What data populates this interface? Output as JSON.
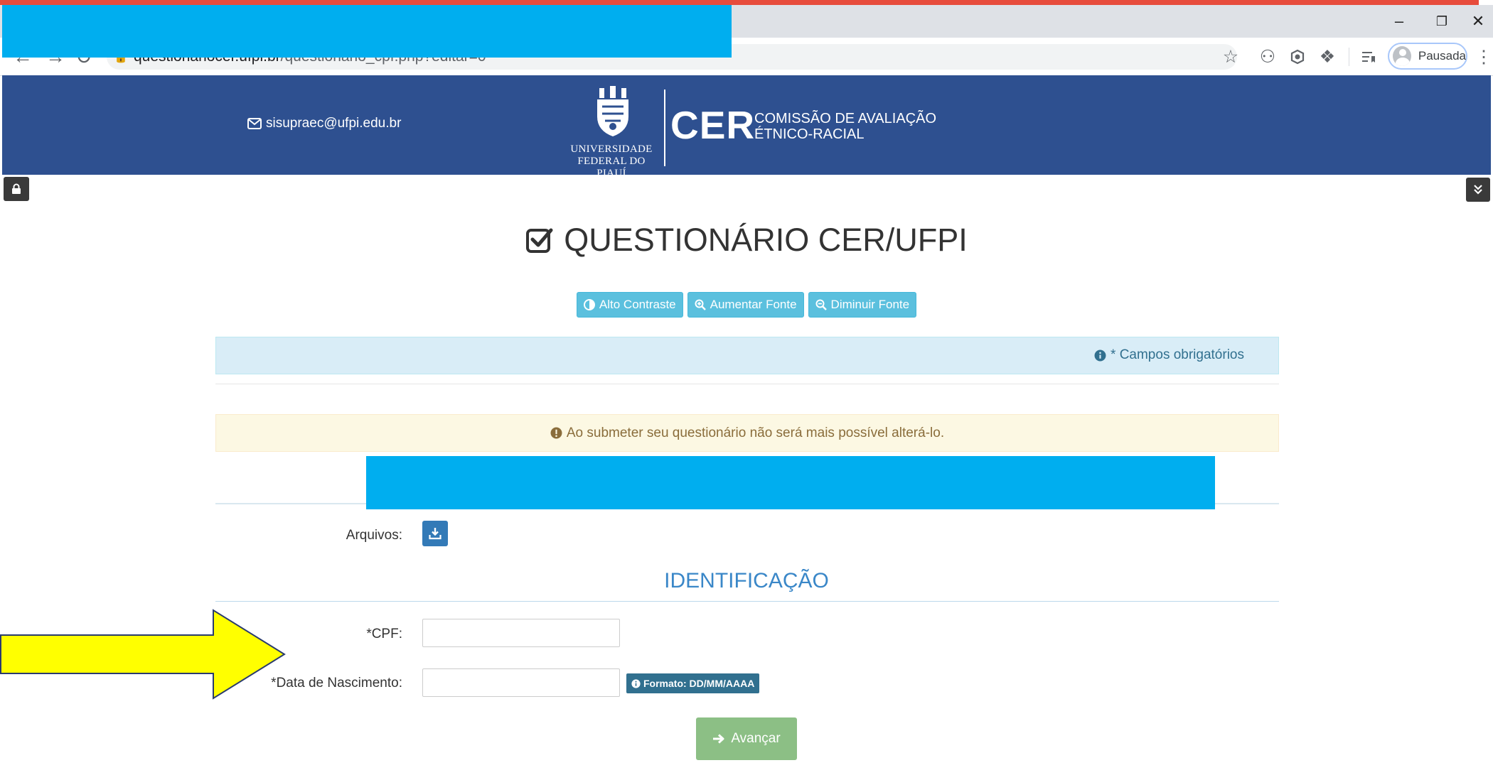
{
  "browser": {
    "url_host": "questionariocer.ufpi.br",
    "url_path": "/questionario_cpf.php?editar=0",
    "profile_label": "Pausada",
    "window_controls": [
      "minimize",
      "restore",
      "close"
    ]
  },
  "header": {
    "email": "sisupraec@ufpi.edu.br",
    "university_line1": "UNIVERSIDADE",
    "university_line2": "FEDERAL DO PIAUÍ",
    "acronym": "CER",
    "subtitle_line1": "COMISSÃO DE AVALIAÇÃO",
    "subtitle_line2": "ÉTNICO-RACIAL"
  },
  "page": {
    "title": "QUESTIONÁRIO CER/UFPI",
    "accessibility": {
      "high_contrast": "Alto Contraste",
      "increase_font": "Aumentar Fonte",
      "decrease_font": "Diminuir Fonte"
    },
    "required_note": "* Campos obrigatórios",
    "warning": "Ao submeter seu questionário não será mais possível alterá-lo.",
    "files_label": "Arquivos:",
    "section_title": "IDENTIFICAÇÃO",
    "cpf_label": "*CPF:",
    "cpf_value": "",
    "birth_label": "*Data de Nascimento:",
    "birth_value": "",
    "format_hint": "Formato: DD/MM/AAAA",
    "next_button": "Avançar"
  },
  "colors": {
    "header_bg": "#2e5090",
    "redaction": "#00aeef",
    "annotation_arrow": "#ffff00",
    "info_bg": "#d9edf7",
    "warning_bg": "#fcf8e3",
    "button_info": "#5bc0de",
    "button_next": "#8cbf85"
  }
}
